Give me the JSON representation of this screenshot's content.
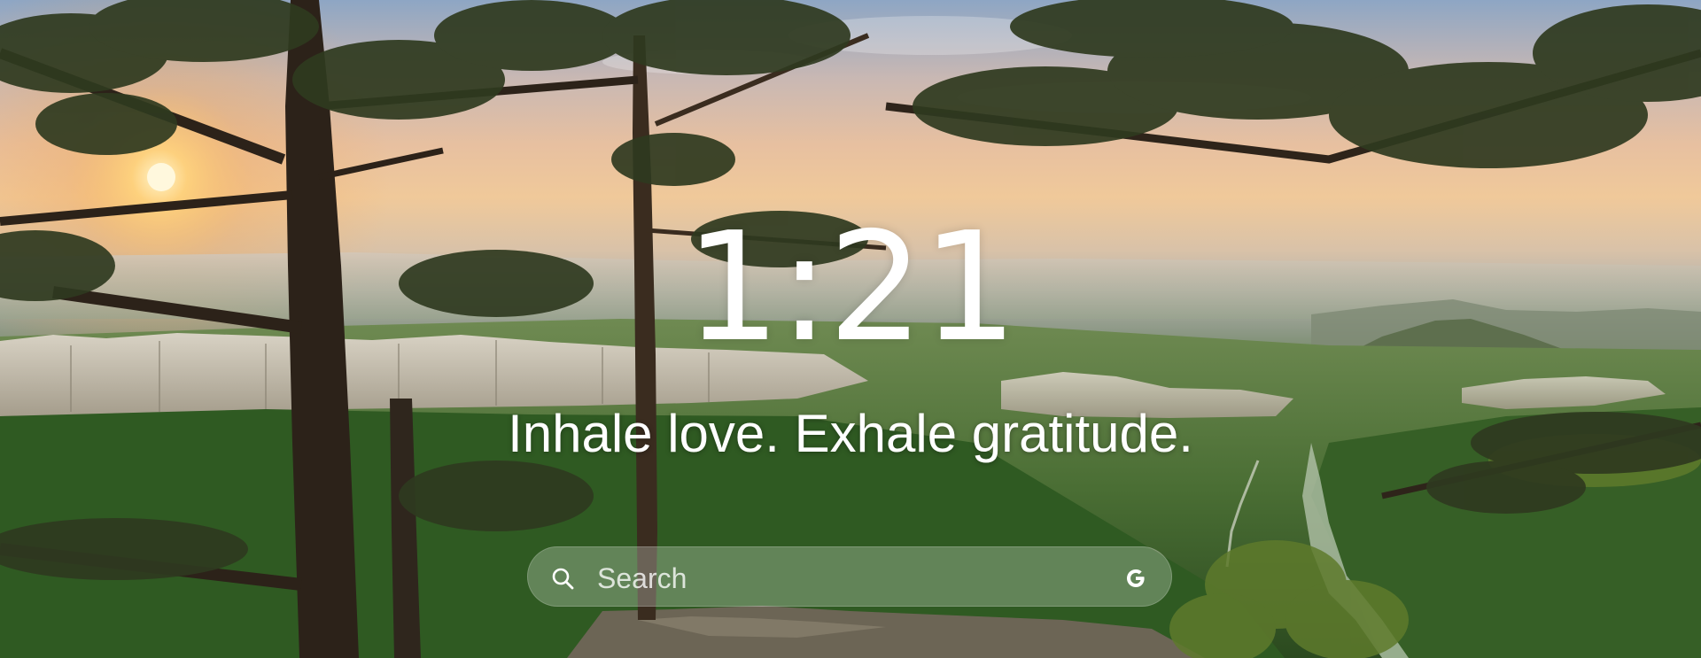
{
  "clock": {
    "time": "1:21"
  },
  "mantra": {
    "text": "Inhale love. Exhale gratitude."
  },
  "search": {
    "placeholder": "Search",
    "value": "",
    "leading_icon": "search-icon",
    "trailing_icon": "google-icon"
  },
  "background": {
    "scene": "sunset-forest-valley",
    "colors": {
      "sky_top": "#8ea6c4",
      "sky_glow": "#f0c99a",
      "sun": "#fff3c4",
      "forest": "#3f6130",
      "cliffs": "#c9c2b3"
    }
  },
  "colors": {
    "text": "#ffffff",
    "search_bg": "rgba(235,240,230,0.28)"
  }
}
